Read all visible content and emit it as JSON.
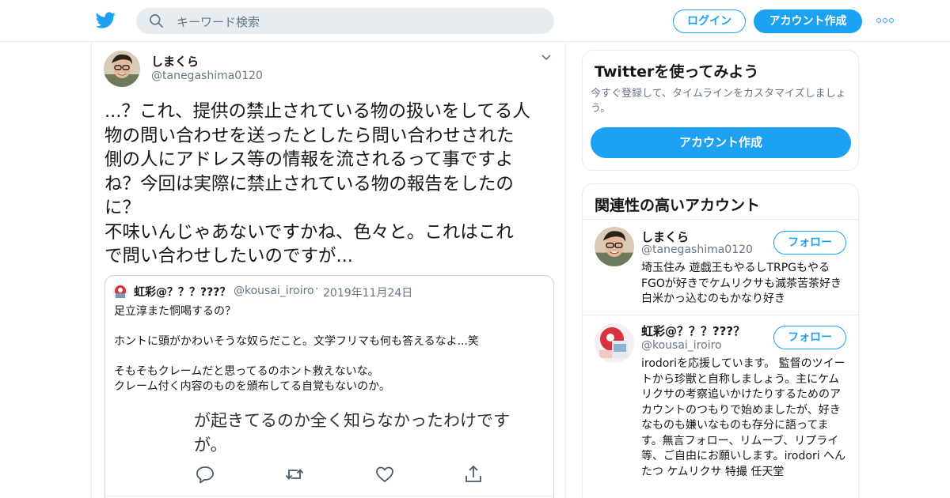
{
  "header": {
    "logo_icon": "twitter-bird-icon",
    "search_placeholder": "キーワード検索",
    "login_label": "ログイン",
    "signup_label": "アカウント作成",
    "more_icon": "more-dots-icon",
    "brand_color": "#1da1f2"
  },
  "tweet": {
    "name": "しまくら",
    "handle": "@tanegashima0120",
    "menu_icon": "chevron-down-icon",
    "text_lines": [
      "...？これ、提供の禁止されている物の扱いをしてる人",
      "物の問い合わせを送ったとしたら問い合わせされた",
      "側の人にアドレス等の情報を流されるって事ですよ",
      "ね？今回は実際に禁止されている物の報告をしたの",
      "に？",
      "不味いんじゃあないですかね、色々と。これはこれ",
      "で問い合わせしたいのですが..."
    ],
    "quote": {
      "name": "虹彩@？？？???？",
      "handle": "@kousai_iroiro",
      "separator": "·",
      "date": "2019年11月24日",
      "lines": [
        "足立淳また恫喝するの？",
        "",
        "ホントに頭がかわいそうな奴らだこと。文学フリマも何も答えるなよ...笑",
        "",
        "そもそもクレームだと思ってるのホント救えないな。",
        "クレーム付く内容のものを頒布してる自覚もないのか。"
      ],
      "image_text_lines": [
        "が起きてるのか全く知らなかったわけです",
        "が。"
      ],
      "actions": [
        "reply-icon",
        "retweet-icon",
        "like-icon",
        "share-icon"
      ]
    }
  },
  "sidebar": {
    "signup_card": {
      "title": "Twitterを使ってみよう",
      "description": "今すぐ登録して、タイムラインをカスタマイズしましょう。",
      "button_label": "アカウント作成"
    },
    "related": {
      "title": "関連性の高いアカウント",
      "accounts": [
        {
          "name": "しまくら",
          "handle": "@tanegashima0120",
          "follow_label": "フォロー",
          "bio": "埼玉住み 遊戯王もやるしTRPGもやるFGOが好きでケムリクサも滅茶苦茶好き 白米かっ込むのもかなり好き"
        },
        {
          "name": "虹彩@？？？???？",
          "handle": "@kousai_iroiro",
          "follow_label": "フォロー",
          "bio": "irodoriを応援しています。 監督のツイートから珍獣と自称しましょう。主にケムリクサの考察追いかけたりするためのアカウントのつもりで始めましたが、好きなものも嫌いなものも存分に語ってます。無言フォロー、リムーブ、リプライ等、ご自由にお願いします。irodori へんたつ ケムリクサ 特撮 任天堂"
        }
      ]
    }
  }
}
